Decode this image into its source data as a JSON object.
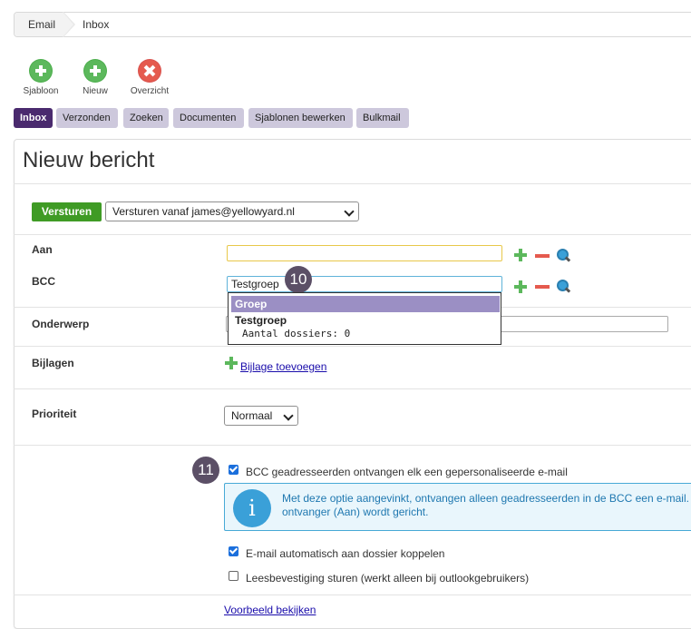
{
  "breadcrumb": {
    "items": [
      "Email",
      "Inbox"
    ]
  },
  "toolbar": {
    "sjabloon": "Sjabloon",
    "nieuw": "Nieuw",
    "overzicht": "Overzicht"
  },
  "tabs": [
    "Inbox",
    "Verzonden",
    "Zoeken",
    "Documenten",
    "Sjablonen bewerken",
    "Bulkmail"
  ],
  "page_title": "Nieuw bericht",
  "send": {
    "button": "Versturen",
    "from_select": "Versturen vanaf james@yellowyard.nl"
  },
  "fields": {
    "aan_label": "Aan",
    "aan_value": "",
    "bcc_label": "BCC",
    "bcc_value": "Testgroep",
    "onderwerp_label": "Onderwerp",
    "onderwerp_value": "",
    "bijlagen_label": "Bijlagen",
    "bijlage_link": "Bijlage toevoegen",
    "prioriteit_label": "Prioriteit",
    "prioriteit_value": "Normaal"
  },
  "autocomplete": {
    "group_header": "Groep",
    "item_title": "Testgroep",
    "item_sub": "Aantal dossiers: 0"
  },
  "badges": {
    "b10": "10",
    "b11": "11"
  },
  "options": {
    "bcc_personal": "BCC geadresseerden ontvangen elk een gepersonaliseerde e-mail",
    "bcc_personal_checked": true,
    "info_text": "Met deze optie aangevinkt, ontvangen alleen geadresseerden in de BCC een e-mail. ontvanger (Aan) wordt gericht.",
    "auto_link": "E-mail automatisch aan dossier koppelen",
    "auto_link_checked": true,
    "read_receipt": "Leesbevestiging sturen (werkt alleen bij outlookgebruikers)",
    "read_receipt_checked": false
  },
  "preview_link": "Voorbeeld bekijken",
  "colors": {
    "accent": "#4a2a6e",
    "tab": "#cdc8dc",
    "send": "#3f9b25",
    "info": "#3aa0d8",
    "badge": "#5b4f66"
  }
}
